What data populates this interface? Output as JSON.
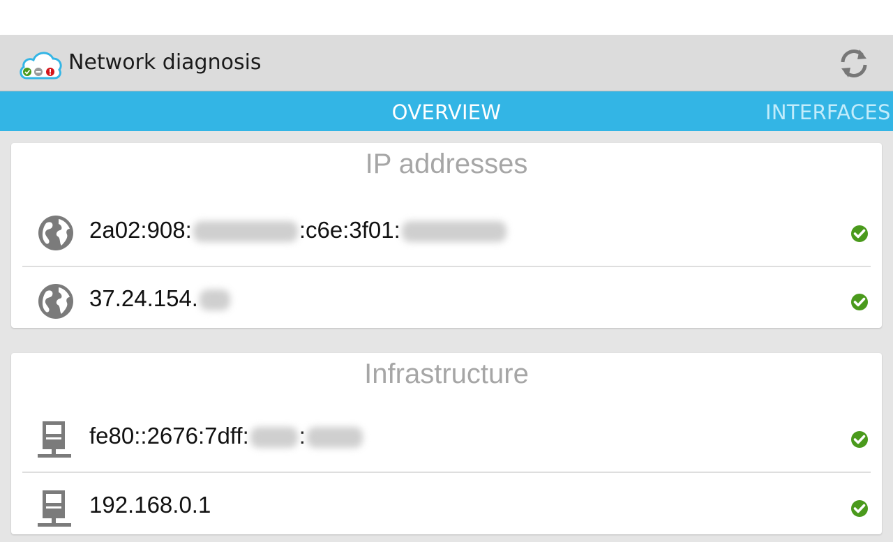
{
  "app": {
    "title": "Network diagnosis"
  },
  "tabs": [
    {
      "label": "OVERVIEW",
      "selected": true
    },
    {
      "label": "INTERFACES",
      "selected": false
    }
  ],
  "colors": {
    "accent": "#33b5e5",
    "ok": "#4a9a1c",
    "icon_gray": "#7b7b7b"
  },
  "sections": [
    {
      "title": "IP addresses",
      "rows": [
        {
          "icon": "globe-icon",
          "prefix": "2a02:908:",
          "middle": ":c6e:3f01:",
          "status": "ok"
        },
        {
          "icon": "globe-icon",
          "prefix": "37.24.154.",
          "status": "ok"
        }
      ]
    },
    {
      "title": "Infrastructure",
      "rows": [
        {
          "icon": "network-device-icon",
          "prefix": "fe80::2676:7dff:",
          "middle": ":",
          "status": "ok"
        },
        {
          "icon": "network-device-icon",
          "prefix": "192.168.0.1",
          "status": "ok"
        }
      ]
    }
  ]
}
